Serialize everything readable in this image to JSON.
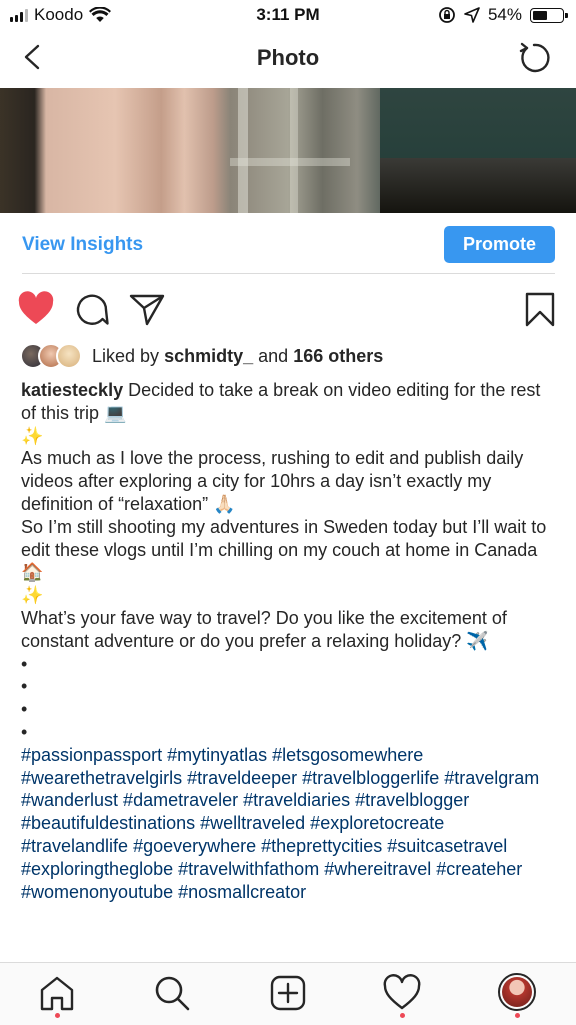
{
  "status_bar": {
    "carrier": "Koodo",
    "time": "3:11 PM",
    "battery_percent": "54%",
    "battery_level": 0.54
  },
  "nav": {
    "title": "Photo"
  },
  "insights": {
    "view_insights": "View Insights",
    "promote": "Promote"
  },
  "likes": {
    "prefix": "Liked by",
    "user": "schmidty_",
    "middle": "and",
    "others": "166 others"
  },
  "caption": {
    "username": "katiesteckly",
    "lines": [
      "Decided to take a break on video editing for the rest of this trip 💻",
      "✨",
      "As much as I love the process, rushing to edit and publish daily videos after exploring a city for 10hrs a day isn’t exactly my definition of “relaxation” 🙏🏻",
      "So I’m still shooting my adventures in Sweden today but I’ll wait to edit these vlogs until I’m chilling on my couch at home in Canada 🏠",
      "✨",
      "What’s your fave way to travel? Do you like the excitement of constant adventure or do you prefer a relaxing holiday? ✈️",
      "•",
      "•",
      "•",
      "•"
    ],
    "hashtags": "#passionpassport #mytinyatlas #letsgosomewhere #wearethetravelgirls #traveldeeper #travelbloggerlife #travelgram #wanderlust #dametraveler #traveldiaries #travelblogger #beautifuldestinations #welltraveled #exploretocreate #travelandlife #goeverywhere #theprettycities #suitcasetravel #exploringtheglobe #travelwithfathom #whereitravel #createher #womenonyoutube #nosmallcreator"
  },
  "colors": {
    "link": "#3897f0",
    "like": "#ed4956",
    "hashtag": "#003569",
    "text": "#262626"
  },
  "icons": {
    "back": "chevron-left-icon",
    "refresh": "refresh-icon",
    "like": "heart-filled-icon",
    "comment": "comment-icon",
    "share": "paper-plane-icon",
    "save": "bookmark-icon",
    "home": "home-icon",
    "search": "search-icon",
    "new_post": "plus-square-icon",
    "activity": "heart-outline-icon"
  }
}
